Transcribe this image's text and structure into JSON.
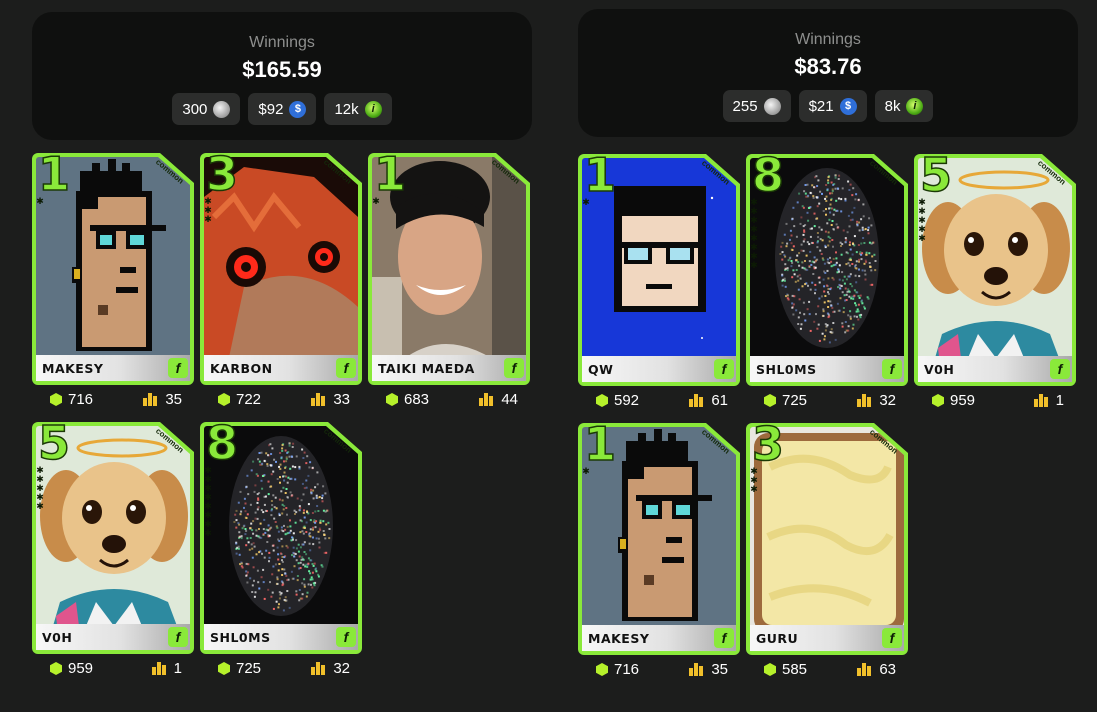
{
  "panels": [
    {
      "winnings_label": "Winnings",
      "winnings_amount": "$165.59",
      "chips": [
        {
          "value": "300",
          "icon": "silver-coin-icon"
        },
        {
          "value": "$92",
          "icon": "usdc-coin-icon"
        },
        {
          "value": "12k",
          "icon": "green-token-icon"
        }
      ],
      "cards": [
        {
          "level": "1",
          "stars": 1,
          "rarity": "common",
          "name": "MAKESY",
          "score": "716",
          "rank": "35",
          "art": "pixel-punk-gray"
        },
        {
          "level": "3",
          "stars": 3,
          "rarity": "common",
          "name": "KARBON",
          "score": "722",
          "rank": "33",
          "art": "red-creature"
        },
        {
          "level": "1",
          "stars": 1,
          "rarity": "common",
          "name": "TAIKI MAEDA",
          "score": "683",
          "rank": "44",
          "art": "photo-portrait"
        },
        {
          "level": "5",
          "stars": 5,
          "rarity": "common",
          "name": "V0H",
          "score": "959",
          "rank": "1",
          "art": "cartoon-dog"
        },
        {
          "level": "8",
          "stars": 8,
          "rarity": "common",
          "name": "SHL0MS",
          "score": "725",
          "rank": "32",
          "art": "noise-head"
        }
      ]
    },
    {
      "winnings_label": "Winnings",
      "winnings_amount": "$83.76",
      "chips": [
        {
          "value": "255",
          "icon": "silver-coin-icon"
        },
        {
          "value": "$21",
          "icon": "usdc-coin-icon"
        },
        {
          "value": "8k",
          "icon": "green-token-icon"
        }
      ],
      "cards": [
        {
          "level": "1",
          "stars": 1,
          "rarity": "common",
          "name": "QW",
          "score": "592",
          "rank": "61",
          "art": "pixel-face-blue"
        },
        {
          "level": "8",
          "stars": 8,
          "rarity": "common",
          "name": "SHL0MS",
          "score": "725",
          "rank": "32",
          "art": "noise-head"
        },
        {
          "level": "5",
          "stars": 5,
          "rarity": "common",
          "name": "V0H",
          "score": "959",
          "rank": "1",
          "art": "cartoon-dog"
        },
        {
          "level": "1",
          "stars": 1,
          "rarity": "common",
          "name": "MAKESY",
          "score": "716",
          "rank": "35",
          "art": "pixel-punk-gray"
        },
        {
          "level": "3",
          "stars": 3,
          "rarity": "common",
          "name": "GURU",
          "score": "585",
          "rank": "63",
          "art": "toast"
        }
      ]
    }
  ],
  "colors": {
    "accent": "#8ae93a",
    "background": "#1c1d1c",
    "summary": "#0f100f",
    "chip": "#2c2d2c",
    "score_icon": "#b6f12b",
    "rank_icon": "#f1c02b"
  }
}
